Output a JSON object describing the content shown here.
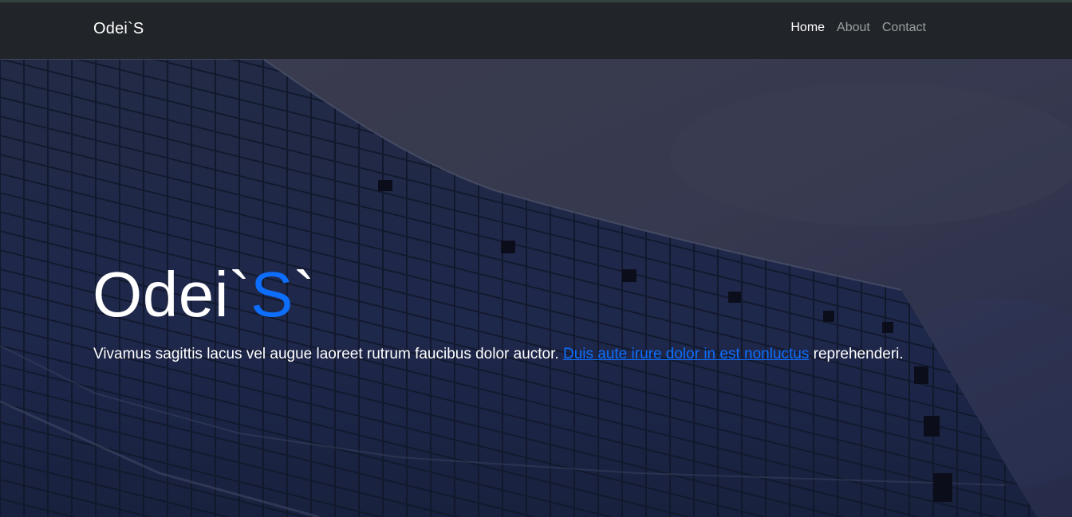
{
  "navbar": {
    "brand": "Odei`S",
    "links": [
      {
        "label": "Home",
        "active": true
      },
      {
        "label": "About",
        "active": false
      },
      {
        "label": "Contact",
        "active": false
      }
    ]
  },
  "hero": {
    "title_main": "Odei`",
    "title_accent": "S",
    "title_tail": "`",
    "text_before": "Vivamus sagittis lacus vel augue laoreet rutrum faucibus dolor auctor. ",
    "link_text": "Duis aute irure dolor in est nonluctus",
    "text_after": " reprehenderi."
  },
  "colors": {
    "navbar_bg": "#212529",
    "accent": "#0d6efd",
    "nav_muted": "rgba(255,255,255,0.55)"
  }
}
